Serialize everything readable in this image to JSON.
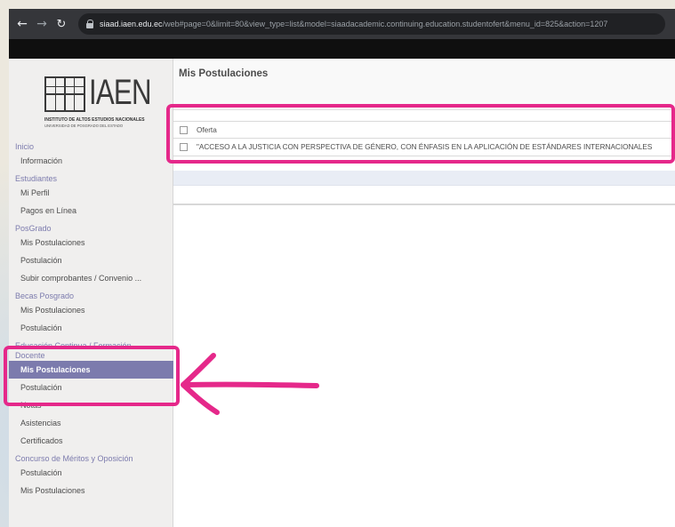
{
  "browser": {
    "url_domain": "siaad.iaen.edu.ec",
    "url_path": "/web#page=0&limit=80&view_type=list&model=siaadacademic.continuing.education.studentofert&menu_id=825&action=1207",
    "back_icon": "arrow-left-icon",
    "forward_icon": "arrow-right-icon",
    "reload_icon": "reload-icon",
    "lock_icon": "lock-icon"
  },
  "logo": {
    "text": "IAEN",
    "subtitle": "INSTITUTO DE ALTOS ESTUDIOS NACIONALES",
    "tagline": "UNIVERSIDAD DE POSGRADO DEL ESTADO"
  },
  "sidebar": {
    "sections": [
      {
        "label": "Inicio",
        "items": [
          "Información"
        ]
      },
      {
        "label": "Estudiantes",
        "items": [
          "Mi Perfil",
          "Pagos en Línea"
        ]
      },
      {
        "label": "PosGrado",
        "items": [
          "Mis Postulaciones",
          "Postulación",
          "Subir comprobantes / Convenio ..."
        ]
      },
      {
        "label": "Becas Posgrado",
        "items": [
          "Mis Postulaciones",
          "Postulación"
        ]
      },
      {
        "label_line1": "Educación Continua / Formación",
        "label_line2": "Docente",
        "items": [
          "Mis Postulaciones",
          "Postulación",
          "Notas",
          "Asistencias",
          "Certificados"
        ],
        "active_index": 0
      },
      {
        "label": "Concurso de Méritos y Oposición",
        "items": [
          "Postulación",
          "Mis Postulaciones"
        ]
      }
    ]
  },
  "main": {
    "title": "Mis Postulaciones",
    "table": {
      "header": "Oferta",
      "rows": [
        "\"ACCESO A LA JUSTICIA CON PERSPECTIVA DE GÉNERO, CON ÉNFASIS EN LA APLICACIÓN DE ESTÁNDARES INTERNACIONALES"
      ]
    }
  },
  "colors": {
    "highlight": "#e5288a",
    "active_menu": "#7c7bad"
  }
}
